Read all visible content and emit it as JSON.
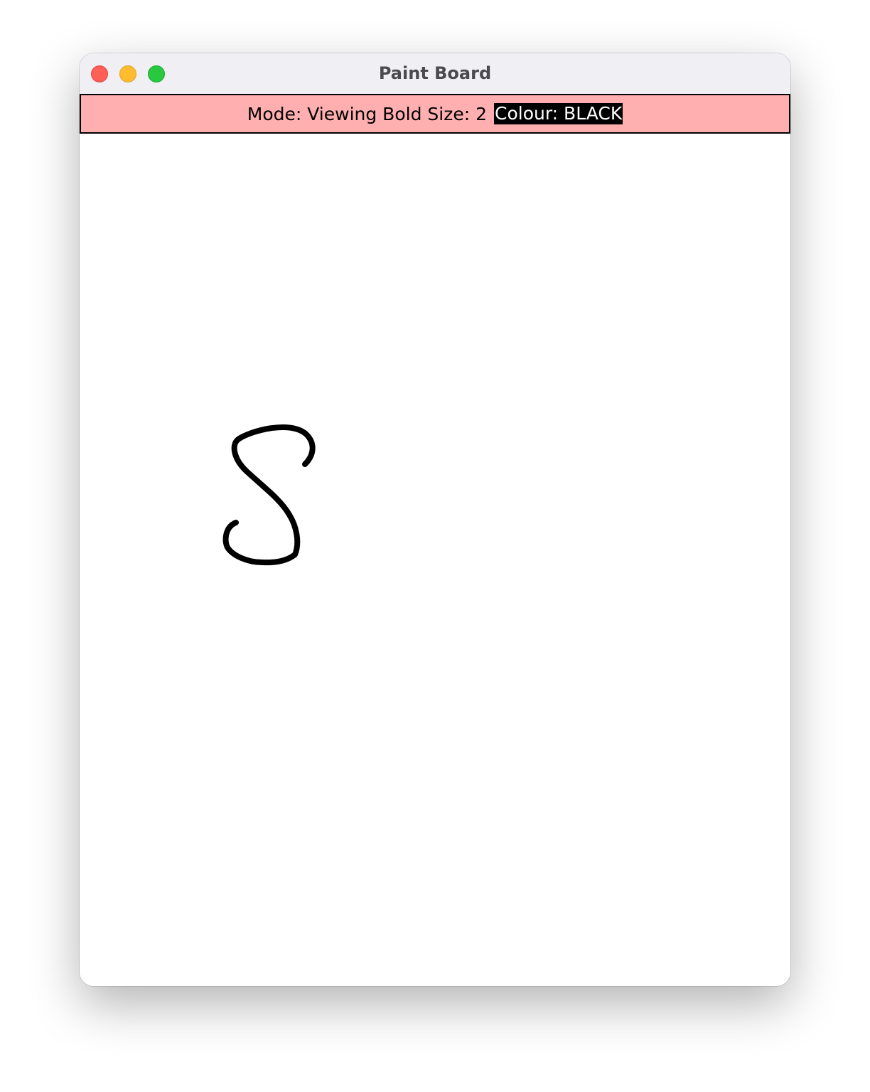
{
  "window": {
    "title": "Paint Board"
  },
  "status": {
    "mode_text": "Mode: Viewing Bold Size: 2",
    "colour_label": "Colour: BLACK"
  },
  "canvas": {
    "stroke_color": "#000000",
    "background_color": "#ffffff"
  },
  "colors": {
    "status_bar_bg": "#ffafaf",
    "close": "#fe5f57",
    "minimize": "#febc2e",
    "zoom": "#28c840"
  }
}
